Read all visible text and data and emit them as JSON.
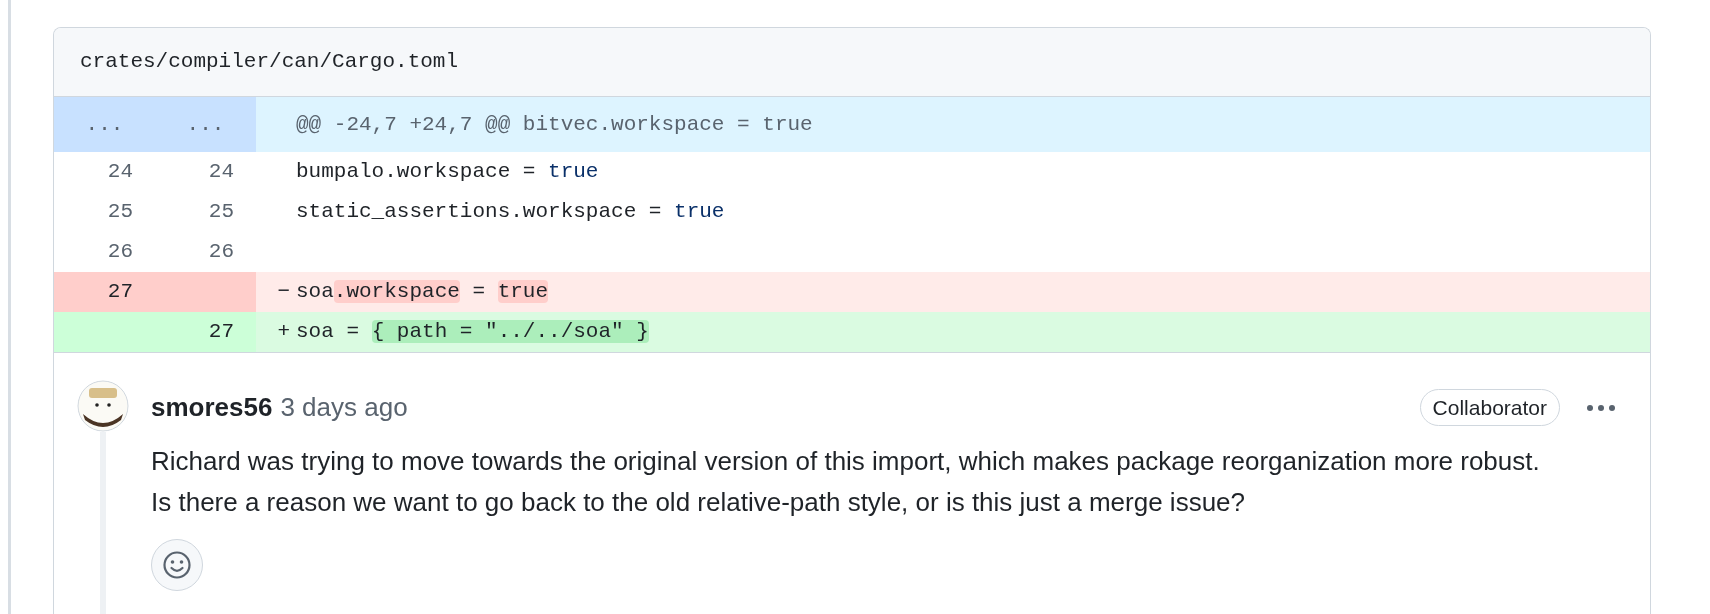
{
  "file": {
    "path": "crates/compiler/can/Cargo.toml"
  },
  "diff_lines": [
    {
      "kind": "hunk",
      "old": "...",
      "new": "...",
      "segments": [
        {
          "text": "@@ -24,7 +24,7 @@ bitvec.workspace = true",
          "kind": "text"
        }
      ]
    },
    {
      "kind": "context",
      "old": "24",
      "new": "24",
      "segments": [
        {
          "text": "bumpalo.workspace = ",
          "kind": "text"
        },
        {
          "text": "true",
          "kind": "keyword"
        }
      ]
    },
    {
      "kind": "context",
      "old": "25",
      "new": "25",
      "segments": [
        {
          "text": "static_assertions.workspace = ",
          "kind": "text"
        },
        {
          "text": "true",
          "kind": "keyword"
        }
      ]
    },
    {
      "kind": "context",
      "old": "26",
      "new": "26"
    },
    {
      "kind": "deletion",
      "old": "27",
      "marker": "−",
      "segments": [
        {
          "text": "soa",
          "kind": "text"
        },
        {
          "text": ".workspace",
          "kind": "changed"
        },
        {
          "text": " = ",
          "kind": "text"
        },
        {
          "text": "true",
          "kind": "changed"
        }
      ]
    },
    {
      "kind": "addition",
      "new": "27",
      "marker": "+",
      "segments": [
        {
          "text": "soa = ",
          "kind": "text"
        },
        {
          "text": "{ path = \"../../soa\" }",
          "kind": "changed"
        }
      ]
    }
  ],
  "comment": {
    "author": "smores56",
    "time": "3 days ago",
    "role": "Collaborator",
    "body": "Richard was trying to move towards the original version of this import, which makes package reorganization more robust. Is there a reason we want to go back to the old relative-path style, or is this just a merge issue?"
  }
}
